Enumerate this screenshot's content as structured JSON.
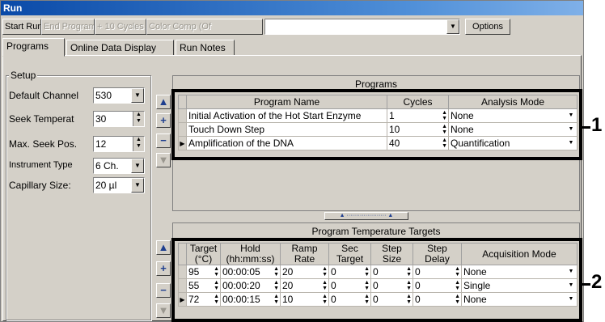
{
  "window": {
    "title": "Run"
  },
  "toolbar": {
    "start_run": "Start Run",
    "end_program": "End Program",
    "plus_10_cycles": "+ 10 Cycles",
    "color_comp": "Color Comp (Of",
    "combo_value": "",
    "options": "Options"
  },
  "tabs": [
    {
      "label": "Programs"
    },
    {
      "label": "Online Data Display"
    },
    {
      "label": "Run Notes"
    }
  ],
  "setup": {
    "title": "Setup",
    "default_channel": {
      "label": "Default Channel",
      "value": "530"
    },
    "seek_temperature": {
      "label": "Seek Temperat",
      "value": "30"
    },
    "max_seek_pos": {
      "label": "Max. Seek Pos.",
      "value": "12"
    },
    "instrument_type": {
      "label": "Instrument Type",
      "value": "6 Ch."
    },
    "capillary_size": {
      "label": "Capillary Size:",
      "value": "20 µl"
    }
  },
  "side_buttons": {
    "up": "▲",
    "add": "+",
    "remove": "−",
    "down": "▼"
  },
  "programs": {
    "header": "Programs",
    "columns": [
      "Program Name",
      "Cycles",
      "Analysis Mode"
    ],
    "rows": [
      {
        "name": "Initial Activation of the Hot Start Enzyme",
        "cycles": "1",
        "mode": "None"
      },
      {
        "name": "Touch Down Step",
        "cycles": "10",
        "mode": "None"
      },
      {
        "name": "Amplification of the DNA",
        "cycles": "40",
        "mode": "Quantification"
      }
    ]
  },
  "splitter": "▲ ····················· ▲",
  "targets": {
    "header": "Program Temperature Targets",
    "columns": [
      [
        "Target",
        "(°C)"
      ],
      [
        "Hold",
        "(hh:mm:ss)"
      ],
      [
        "Ramp",
        "Rate"
      ],
      [
        "Sec",
        "Target"
      ],
      [
        "Step",
        "Size"
      ],
      [
        "Step",
        "Delay"
      ],
      [
        "Acquisition Mode",
        ""
      ]
    ],
    "rows": [
      {
        "target": "95",
        "hold": "00:00:05",
        "ramp": "20",
        "sec": "0",
        "step_size": "0",
        "step_delay": "0",
        "acq": "None"
      },
      {
        "target": "55",
        "hold": "00:00:20",
        "ramp": "20",
        "sec": "0",
        "step_size": "0",
        "step_delay": "0",
        "acq": "Single"
      },
      {
        "target": "72",
        "hold": "00:00:15",
        "ramp": "10",
        "sec": "0",
        "step_size": "0",
        "step_delay": "0",
        "acq": "None"
      }
    ]
  },
  "callouts": {
    "one": "1",
    "two": "2"
  }
}
